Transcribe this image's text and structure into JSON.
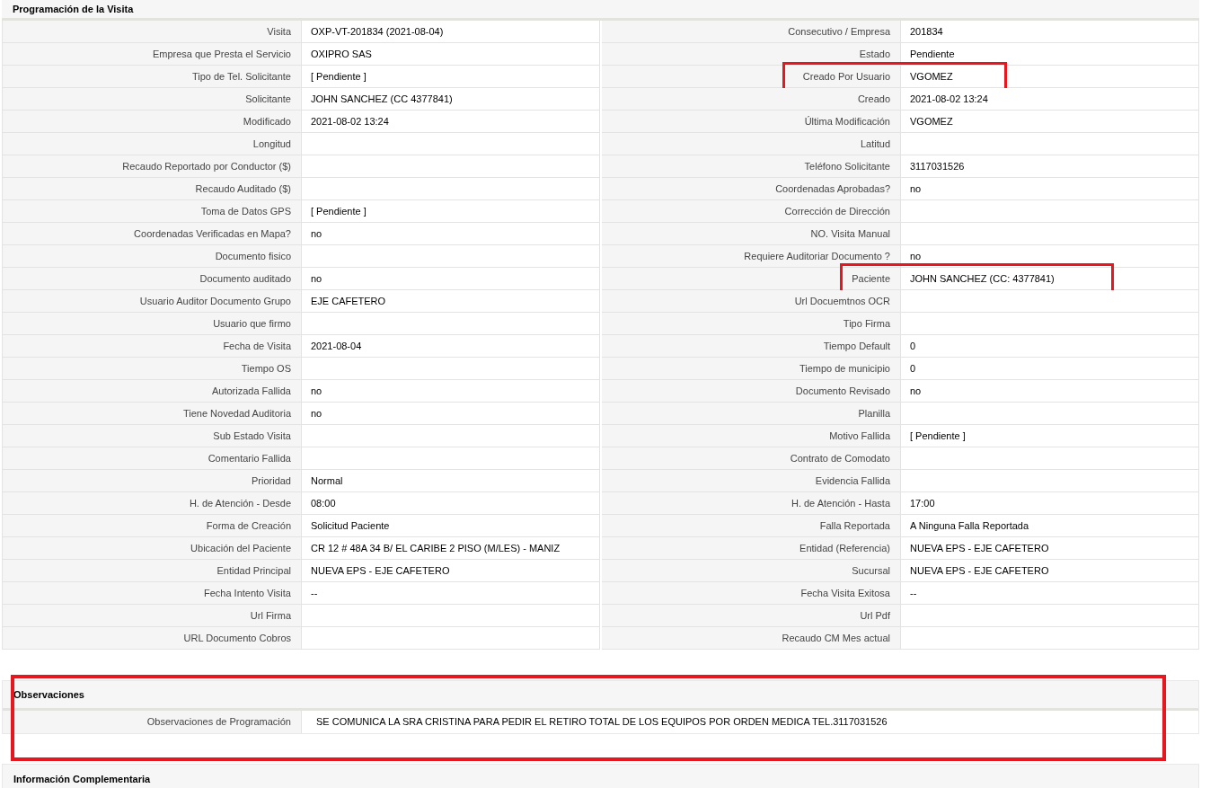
{
  "sections": [
    {
      "title": "Programación de la Visita",
      "highlighted": false,
      "rows": [
        {
          "left": {
            "label": "Visita",
            "value": "OXP-VT-201834 (2021-08-04)",
            "highlighted": false
          },
          "right": {
            "label": "Consecutivo / Empresa",
            "value": "201834",
            "highlighted": false
          }
        },
        {
          "left": {
            "label": "Empresa que Presta el Servicio",
            "value": "OXIPRO SAS",
            "highlighted": false
          },
          "right": {
            "label": "Estado",
            "value": "Pendiente",
            "highlighted": false
          }
        },
        {
          "left": {
            "label": "Tipo de Tel. Solicitante",
            "value": "[ Pendiente ]",
            "highlighted": false
          },
          "right": {
            "label": "Creado Por Usuario",
            "value": "VGOMEZ",
            "highlighted": true
          }
        },
        {
          "left": {
            "label": "Solicitante",
            "value": "JOHN SANCHEZ (CC 4377841)",
            "highlighted": false
          },
          "right": {
            "label": "Creado",
            "value": "2021-08-02 13:24",
            "highlighted": false
          }
        },
        {
          "left": {
            "label": "Modificado",
            "value": "2021-08-02 13:24",
            "highlighted": false
          },
          "right": {
            "label": "Última Modificación",
            "value": "VGOMEZ",
            "highlighted": false
          }
        },
        {
          "left": {
            "label": "Longitud",
            "highlighted": false
          },
          "right": {
            "label": "Latitud",
            "highlighted": false
          }
        },
        {
          "left": {
            "label": "Recaudo Reportado por Conductor ($)",
            "highlighted": false
          },
          "right": {
            "label": "Teléfono Solicitante",
            "value": "3117031526",
            "highlighted": false
          }
        },
        {
          "left": {
            "label": "Recaudo Auditado ($)",
            "highlighted": false
          },
          "right": {
            "label": "Coordenadas Aprobadas?",
            "value": "no",
            "highlighted": false
          }
        },
        {
          "left": {
            "label": "Toma de Datos GPS",
            "value": "[ Pendiente ]",
            "highlighted": false
          },
          "right": {
            "label": "Corrección de Dirección",
            "highlighted": false
          }
        },
        {
          "left": {
            "label": "Coordenadas Verificadas en Mapa?",
            "value": "no",
            "highlighted": false
          },
          "right": {
            "label": "NO. Visita Manual",
            "highlighted": false
          }
        },
        {
          "left": {
            "label": "Documento fisico",
            "highlighted": false
          },
          "right": {
            "label": "Requiere Auditoriar Documento ?",
            "value": "no",
            "highlighted": false
          }
        },
        {
          "left": {
            "label": "Documento auditado",
            "value": "no",
            "highlighted": false
          },
          "right": {
            "label": "Paciente",
            "value": "JOHN SANCHEZ (CC: 4377841)",
            "highlighted": true
          }
        },
        {
          "left": {
            "label": "Usuario Auditor Documento Grupo",
            "value": "EJE CAFETERO",
            "highlighted": false
          },
          "right": {
            "label": "Url Docuemtnos OCR",
            "highlighted": false
          }
        },
        {
          "left": {
            "label": "Usuario que firmo",
            "highlighted": false
          },
          "right": {
            "label": "Tipo Firma",
            "highlighted": false
          }
        },
        {
          "left": {
            "label": "Fecha de Visita",
            "value": "2021-08-04",
            "highlighted": false
          },
          "right": {
            "label": "Tiempo Default",
            "value": "0",
            "highlighted": false
          }
        },
        {
          "left": {
            "label": "Tiempo OS",
            "highlighted": false
          },
          "right": {
            "label": "Tiempo de municipio",
            "value": "0",
            "highlighted": false
          }
        },
        {
          "left": {
            "label": "Autorizada Fallida",
            "value": "no",
            "highlighted": false
          },
          "right": {
            "label": "Documento Revisado",
            "value": "no",
            "highlighted": false
          }
        },
        {
          "left": {
            "label": "Tiene Novedad Auditoria",
            "value": "no",
            "highlighted": false
          },
          "right": {
            "label": "Planilla",
            "highlighted": false
          }
        },
        {
          "left": {
            "label": "Sub Estado Visita",
            "highlighted": false
          },
          "right": {
            "label": "Motivo Fallida",
            "value": "[ Pendiente ]",
            "highlighted": false
          }
        },
        {
          "left": {
            "label": "Comentario Fallida",
            "highlighted": false
          },
          "right": {
            "label": "Contrato de Comodato",
            "highlighted": false
          }
        },
        {
          "left": {
            "label": "Prioridad",
            "value": "Normal",
            "highlighted": false
          },
          "right": {
            "label": "Evidencia Fallida",
            "highlighted": false
          }
        },
        {
          "left": {
            "label": "H. de Atención - Desde",
            "value": "08:00",
            "highlighted": false
          },
          "right": {
            "label": "H. de Atención - Hasta",
            "value": "17:00",
            "highlighted": false
          }
        },
        {
          "left": {
            "label": "Forma de Creación",
            "value": "Solicitud Paciente",
            "highlighted": false
          },
          "right": {
            "label": "Falla Reportada",
            "value": "A Ninguna Falla Reportada",
            "highlighted": false
          }
        },
        {
          "left": {
            "label": "Ubicación del Paciente",
            "value": "CR 12 # 48A 34 B/ EL CARIBE 2 PISO (M/LES) - MANIZ",
            "highlighted": false
          },
          "right": {
            "label": "Entidad (Referencia)",
            "value": "NUEVA EPS - EJE CAFETERO",
            "highlighted": false
          }
        },
        {
          "left": {
            "label": "Entidad Principal",
            "value": "NUEVA EPS - EJE CAFETERO",
            "highlighted": false
          },
          "right": {
            "label": "Sucursal",
            "value": "NUEVA EPS - EJE CAFETERO",
            "highlighted": false
          }
        },
        {
          "left": {
            "label": "Fecha Intento Visita",
            "value": "--",
            "highlighted": false
          },
          "right": {
            "label": "Fecha Visita Exitosa",
            "value": "--",
            "highlighted": false
          }
        },
        {
          "left": {
            "label": "Url Firma",
            "highlighted": false
          },
          "right": {
            "label": "Url Pdf",
            "highlighted": false
          }
        },
        {
          "left": {
            "label": "URL Documento Cobros",
            "highlighted": false
          },
          "right": {
            "label": "Recaudo CM Mes actual",
            "highlighted": false
          }
        }
      ]
    },
    {
      "title": "Observaciones",
      "highlighted": true,
      "fields": [
        {
          "label": "Observaciones de Programación",
          "value": "SE COMUNICA LA SRA CRISTINA PARA PEDIR EL RETIRO TOTAL DE LOS EQUIPOS POR ORDEN MEDICA TEL.3117031526"
        }
      ]
    },
    {
      "title": "Información Complementaria",
      "highlighted": false
    }
  ]
}
